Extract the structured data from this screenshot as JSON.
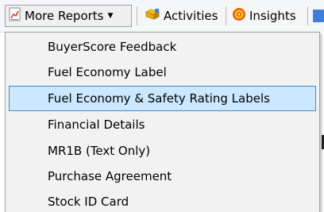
{
  "toolbar": {
    "more_reports_label": "More Reports",
    "activities_label": "Activities",
    "insights_label": "Insights"
  },
  "menu": {
    "items": [
      {
        "label": "BuyerScore Feedback"
      },
      {
        "label": "Fuel Economy Label"
      },
      {
        "label": "Fuel Economy & Safety Rating Labels"
      },
      {
        "label": "Financial Details"
      },
      {
        "label": "MR1B (Text Only)"
      },
      {
        "label": "Purchase Agreement"
      },
      {
        "label": "Stock ID Card"
      }
    ],
    "highlighted_index": 2
  },
  "colors": {
    "highlight_fill": "#cce8ff",
    "highlight_border": "#3c8ad6",
    "menu_bg": "#f2f2f2"
  },
  "icons": {
    "more_reports": "report-chart-icon",
    "activities": "activities-folder-icon",
    "insights": "insights-target-icon"
  }
}
